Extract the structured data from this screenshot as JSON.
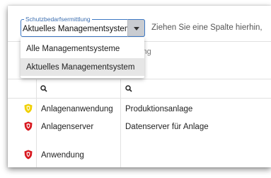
{
  "toolbar": {
    "select_legend": "Schutzbedarfsermittlung",
    "select_value": "Aktuelles Managementsystem",
    "group_hint": "Ziehen Sie eine Spalte hierhin,"
  },
  "dropdown": {
    "options": [
      "Alle Managementsysteme",
      "Aktuelles Managementsystem"
    ],
    "selected_index": 1
  },
  "grid": {
    "column_header_visible": "reibung",
    "rows": [
      {
        "level": "mittel",
        "color": "#f0d000",
        "name": "Anlagenanwendung",
        "desc": "Produktionsanlage"
      },
      {
        "level": "hoch",
        "color": "#d8181f",
        "name": "Anlagenserver",
        "desc": "Datenserver für Anlage"
      },
      {
        "level": "hoch",
        "color": "#d8181f",
        "name": "Anwendung",
        "desc": ""
      }
    ]
  },
  "colors": {
    "accent": "#3d78c4",
    "shield_yellow": "#f0d000",
    "shield_red": "#d8181f"
  }
}
